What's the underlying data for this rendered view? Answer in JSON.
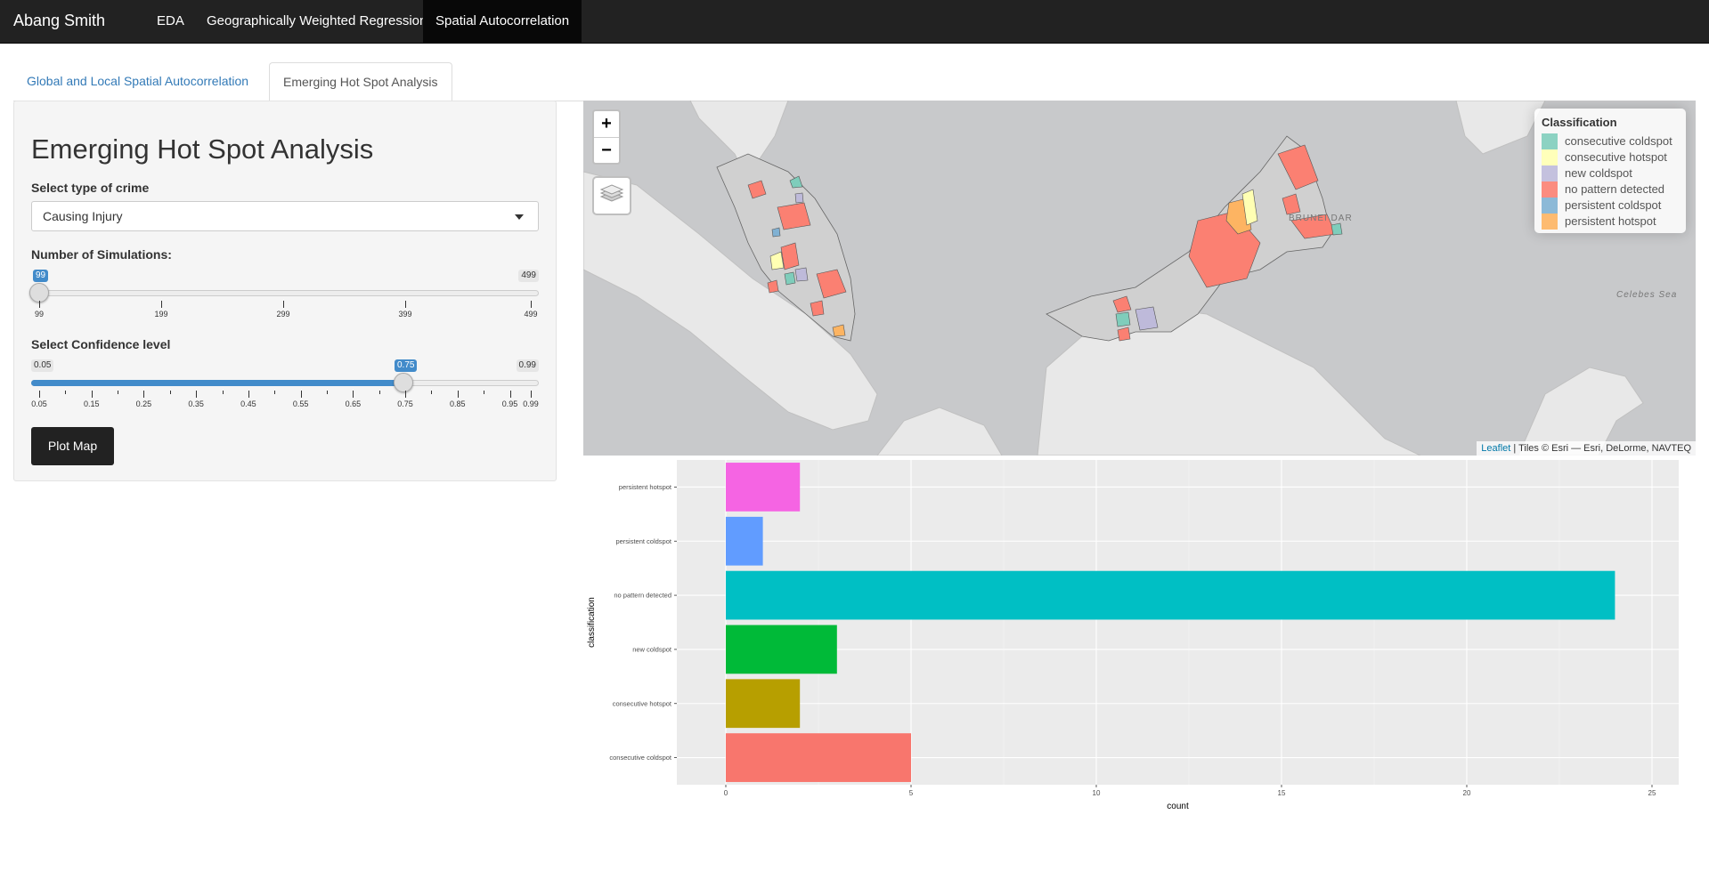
{
  "navbar": {
    "brand": "Abang Smith",
    "items": [
      {
        "label": "EDA",
        "active": false
      },
      {
        "label": "Geographically Weighted Regression",
        "active": false
      },
      {
        "label": "Spatial Autocorrelation",
        "active": true
      }
    ]
  },
  "tabs": [
    {
      "label": "Global and Local Spatial Autocorrelation",
      "active": false
    },
    {
      "label": "Emerging Hot Spot Analysis",
      "active": true
    }
  ],
  "sidebar": {
    "title": "Emerging Hot Spot Analysis",
    "crime_label": "Select type of crime",
    "crime_value": "Causing Injury",
    "sim_label": "Number of Simulations:",
    "sim": {
      "min": "99",
      "max": "499",
      "value": "99",
      "ticks": [
        "99",
        "199",
        "299",
        "399",
        "499"
      ]
    },
    "conf_label": "Select Confidence level",
    "conf": {
      "min": "0.05",
      "max": "0.99",
      "value": "0.75",
      "ticks": [
        "0.05",
        "0.15",
        "0.25",
        "0.35",
        "0.45",
        "0.55",
        "0.65",
        "0.75",
        "0.85",
        "0.95",
        "0.99"
      ]
    },
    "button_label": "Plot Map"
  },
  "map": {
    "zoom_in": "+",
    "zoom_out": "−",
    "layers_icon": "layers-icon",
    "legend_title": "Classification",
    "legend": [
      {
        "label": "consecutive coldspot",
        "color": "#7fcdbb"
      },
      {
        "label": "consecutive hotspot",
        "color": "#ffffb3"
      },
      {
        "label": "new coldspot",
        "color": "#bebada"
      },
      {
        "label": "no pattern detected",
        "color": "#fb8072"
      },
      {
        "label": "persistent coldspot",
        "color": "#80b1d3"
      },
      {
        "label": "persistent hotspot",
        "color": "#fdb462"
      }
    ],
    "labels": {
      "brunei": "BRUNEI DAR",
      "celebes": "Celebes Sea"
    },
    "attribution_link": "Leaflet",
    "attribution_text": " | Tiles © Esri — Esri, DeLorme, NAVTEQ"
  },
  "chart_data": {
    "type": "bar",
    "orientation": "horizontal",
    "categories": [
      "persistent hotspot",
      "persistent coldspot",
      "no pattern detected",
      "new coldspot",
      "consecutive hotspot",
      "consecutive coldspot"
    ],
    "values": [
      2,
      1,
      24,
      3,
      2,
      5
    ],
    "colors": [
      "#f564e3",
      "#619cff",
      "#00bfc4",
      "#00ba38",
      "#b79f00",
      "#f8766d"
    ],
    "xlabel": "count",
    "ylabel": "classification",
    "xticks": [
      "0",
      "5",
      "10",
      "15",
      "20",
      "25"
    ],
    "xlim": [
      0,
      25
    ]
  }
}
